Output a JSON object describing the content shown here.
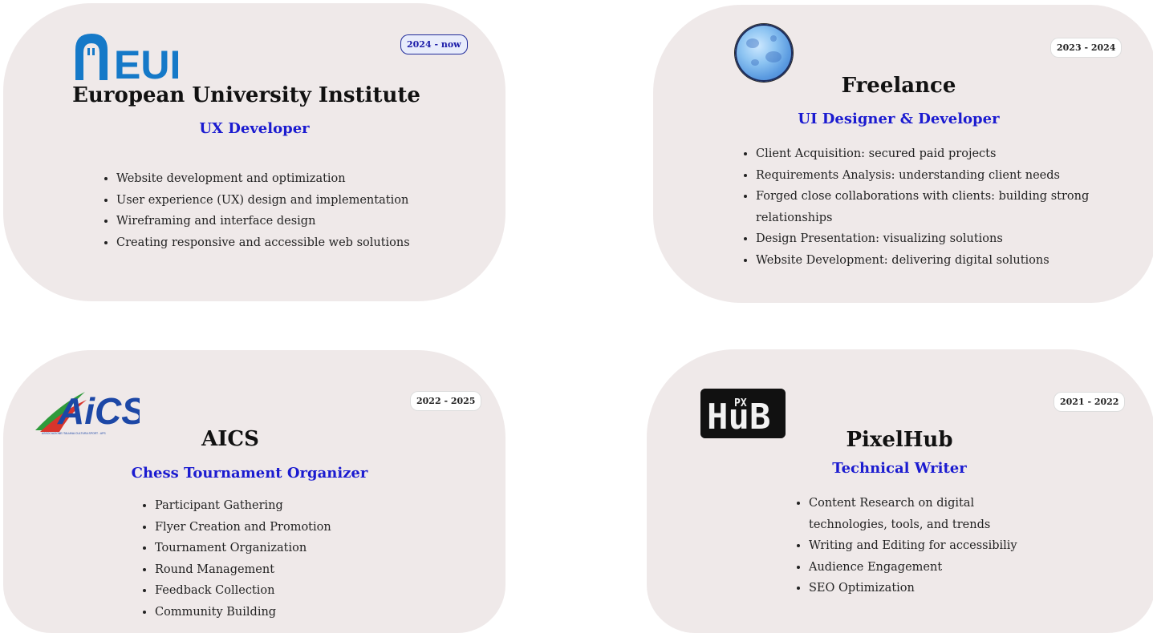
{
  "experiences": [
    {
      "org": "European University Institute",
      "role": "UX Developer",
      "period": "2024 - now",
      "logo_text": "EUI",
      "icon": "eui-logo-icon",
      "duties": [
        "Website development and optimization",
        "User experience (UX) design and implementation",
        "Wireframing and interface design",
        "Creating responsive and accessible web solutions"
      ]
    },
    {
      "org": "Freelance",
      "role": "UI Designer & Developer",
      "period": "2023 - 2024",
      "icon": "moon-logo-icon",
      "duties": [
        "Client Acquisition: secured paid projects",
        "Requirements Analysis: understanding client needs",
        "Forged close collaborations with clients: building strong relationships",
        "Design Presentation: visualizing solutions",
        "Website Development: delivering digital solutions"
      ]
    },
    {
      "org": "AICS",
      "role": "Chess Tournament Organizer",
      "period": "2022 - 2025",
      "logo_text": "AiCS",
      "logo_subtext": "ASSOCIAZIONE ITALIANA CULTURA SPORT - APS",
      "icon": "aics-logo-icon",
      "duties": [
        "Participant Gathering",
        "Flyer Creation and Promotion",
        "Tournament Organization",
        "Round Management",
        "Feedback Collection",
        "Community Building"
      ]
    },
    {
      "org": "PixelHub",
      "role": "Technical Writer",
      "period": "2021 - 2022",
      "logo_text": "HuB",
      "logo_subtext": "PX",
      "icon": "pixelhub-logo-icon",
      "duties": [
        "Content Research on digital technologies, tools, and trends",
        "Writing and Editing for accessibiliy",
        "Audience Engagement",
        "SEO Optimization"
      ]
    }
  ],
  "colors": {
    "card_bg": "#efe9e9",
    "role_text": "#1b1bd0",
    "current_badge_border": "#1f2a9a"
  }
}
